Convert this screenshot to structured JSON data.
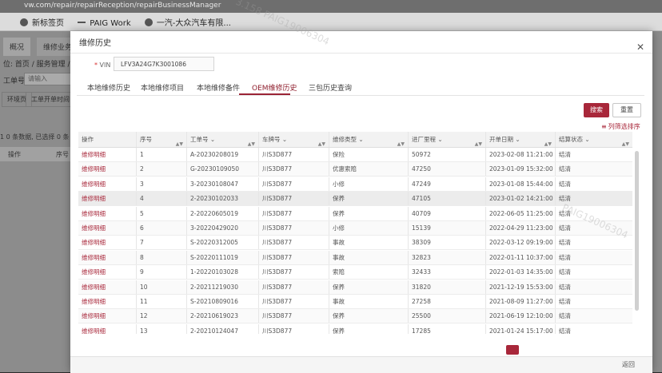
{
  "browser": {
    "url_fragment": "vw.com/repair/repairReception/repairBusinessManager",
    "bookmarks": [
      {
        "label": "新标签页"
      },
      {
        "label": "PAIG Work"
      },
      {
        "label": "一汽-大众汽车有限..."
      }
    ]
  },
  "background_app": {
    "tabs": [
      "概况",
      "维修业务"
    ],
    "breadcrumb": "位: 首页 / 服务管理 / 服",
    "field_label": "工单号",
    "field_placeholder": "请输入",
    "buttons": [
      "环境页",
      "工单开单时间"
    ],
    "count_text": "1 0 条数据, 已选择 0 条",
    "table_headers": [
      "操作",
      "序号"
    ]
  },
  "modal": {
    "title": "维修历史",
    "vin": {
      "label": "VIN",
      "value": "LFV3A24G7K3001086"
    },
    "tabs": [
      "本地维修历史",
      "本地维修项目",
      "本地维修备件",
      "OEM维修历史",
      "三包历史查询"
    ],
    "active_tab": "OEM维修历史",
    "search_button": "搜索",
    "reset_button": "重置",
    "sort_link": "列筛选排序",
    "back_button": "返回",
    "accent_color": "#a8273a",
    "table": {
      "headers": [
        "操作",
        "序号",
        "工单号",
        "车牌号",
        "维修类型",
        "进厂里程",
        "开单日期",
        "结算状态"
      ],
      "rows": [
        {
          "op": "维修明细",
          "no": "1",
          "order": "A-20230208019",
          "plate": "川S3D877",
          "type": "保险",
          "mileage": "50972",
          "date": "2023-02-08 11:21:00",
          "status": "结清"
        },
        {
          "op": "维修明细",
          "no": "2",
          "order": "G-20230109050",
          "plate": "川S3D877",
          "type": "优惠索赔",
          "mileage": "47250",
          "date": "2023-01-09 15:32:00",
          "status": "结清"
        },
        {
          "op": "维修明细",
          "no": "3",
          "order": "3-20230108047",
          "plate": "川S3D877",
          "type": "小修",
          "mileage": "47249",
          "date": "2023-01-08 15:44:00",
          "status": "结清"
        },
        {
          "op": "维修明细",
          "no": "4",
          "order": "2-20230102033",
          "plate": "川S3D877",
          "type": "保养",
          "mileage": "47105",
          "date": "2023-01-02 14:21:00",
          "status": "结清"
        },
        {
          "op": "维修明细",
          "no": "5",
          "order": "2-20220605019",
          "plate": "川S3D877",
          "type": "保养",
          "mileage": "40709",
          "date": "2022-06-05 11:25:00",
          "status": "结清"
        },
        {
          "op": "维修明细",
          "no": "6",
          "order": "3-20220429020",
          "plate": "川S3D877",
          "type": "小修",
          "mileage": "15139",
          "date": "2022-04-29 11:23:00",
          "status": "结清"
        },
        {
          "op": "维修明细",
          "no": "7",
          "order": "S-20220312005",
          "plate": "川S3D877",
          "type": "事故",
          "mileage": "38309",
          "date": "2022-03-12 09:19:00",
          "status": "结清"
        },
        {
          "op": "维修明细",
          "no": "8",
          "order": "S-20220111019",
          "plate": "川S3D877",
          "type": "事故",
          "mileage": "32823",
          "date": "2022-01-11 10:37:00",
          "status": "结清"
        },
        {
          "op": "维修明细",
          "no": "9",
          "order": "1-20220103028",
          "plate": "川S3D877",
          "type": "索赔",
          "mileage": "32433",
          "date": "2022-01-03 14:35:00",
          "status": "结清"
        },
        {
          "op": "维修明细",
          "no": "10",
          "order": "2-20211219030",
          "plate": "川S3D877",
          "type": "保养",
          "mileage": "31820",
          "date": "2021-12-19 15:53:00",
          "status": "结清"
        },
        {
          "op": "维修明细",
          "no": "11",
          "order": "S-20210809016",
          "plate": "川S3D877",
          "type": "事故",
          "mileage": "27258",
          "date": "2021-08-09 11:27:00",
          "status": "结清"
        },
        {
          "op": "维修明细",
          "no": "12",
          "order": "2-20210619023",
          "plate": "川S3D877",
          "type": "保养",
          "mileage": "25500",
          "date": "2021-06-19 12:10:00",
          "status": "结清"
        },
        {
          "op": "维修明细",
          "no": "13",
          "order": "2-20210124047",
          "plate": "川S3D877",
          "type": "保养",
          "mileage": "17285",
          "date": "2021-01-24 15:17:00",
          "status": "结清"
        }
      ]
    }
  },
  "watermarks": [
    "3.158 PAIG19006304",
    "PAIG19006304"
  ]
}
